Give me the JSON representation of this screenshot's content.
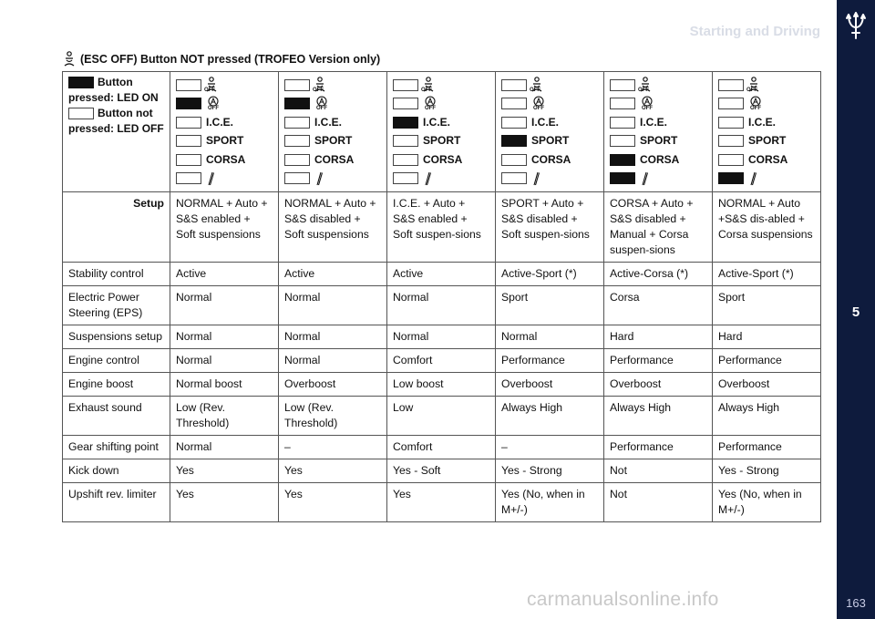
{
  "header": {
    "title": "Starting and Driving"
  },
  "sidebar": {
    "chapter": "5",
    "page": "163",
    "logo": "trident-icon"
  },
  "section": {
    "heading": "(ESC OFF) Button NOT pressed (TROFEO Version only)",
    "icon": "esc-off-icon"
  },
  "legend": {
    "on_label": "Button pressed: LED ON",
    "off_label": "Button not pressed: LED OFF"
  },
  "switch_labels": {
    "esc_off": "OFF",
    "auto_off": "OFF",
    "ice": "I.C.E.",
    "sport": "SPORT",
    "corsa": "CORSA"
  },
  "columns": [
    {
      "on": [
        false,
        true,
        false,
        false,
        false,
        false
      ],
      "setup": "NORMAL + Auto + S&S enabled + Soft suspensions"
    },
    {
      "on": [
        false,
        true,
        false,
        false,
        false,
        false
      ],
      "setup": "NORMAL + Auto + S&S disabled + Soft suspensions"
    },
    {
      "on": [
        false,
        false,
        true,
        false,
        false,
        false
      ],
      "setup": "I.C.E. + Auto + S&S enabled + Soft suspen-sions"
    },
    {
      "on": [
        false,
        false,
        false,
        true,
        false,
        false
      ],
      "setup": "SPORT + Auto + S&S disabled + Soft suspen-sions"
    },
    {
      "on": [
        false,
        false,
        false,
        false,
        true,
        true
      ],
      "setup": "CORSA + Auto + S&S disabled + Manual + Corsa suspen-sions"
    },
    {
      "on": [
        false,
        false,
        false,
        false,
        false,
        true
      ],
      "setup": "NORMAL + Auto +S&S dis-abled + Corsa suspensions"
    }
  ],
  "setup_label": "Setup",
  "rows": [
    {
      "label": "Stability control",
      "values": [
        "Active",
        "Active",
        "Active",
        "Active-Sport (*)",
        "Active-Corsa (*)",
        "Active-Sport (*)"
      ]
    },
    {
      "label": "Electric Power Steering (EPS)",
      "values": [
        "Normal",
        "Normal",
        "Normal",
        "Sport",
        "Corsa",
        "Sport"
      ]
    },
    {
      "label": "Suspensions setup",
      "values": [
        "Normal",
        "Normal",
        "Normal",
        "Normal",
        "Hard",
        "Hard"
      ]
    },
    {
      "label": "Engine control",
      "values": [
        "Normal",
        "Normal",
        "Comfort",
        "Performance",
        "Performance",
        "Performance"
      ]
    },
    {
      "label": "Engine boost",
      "values": [
        "Normal boost",
        "Overboost",
        "Low boost",
        "Overboost",
        "Overboost",
        "Overboost"
      ]
    },
    {
      "label": "Exhaust sound",
      "values": [
        "Low (Rev. Threshold)",
        "Low (Rev. Threshold)",
        "Low",
        "Always High",
        "Always High",
        "Always High"
      ]
    },
    {
      "label": "Gear shifting point",
      "values": [
        "Normal",
        "–",
        "Comfort",
        "–",
        "Performance",
        "Performance"
      ]
    },
    {
      "label": "Kick down",
      "values": [
        "Yes",
        "Yes",
        "Yes - Soft",
        "Yes - Strong",
        "Not",
        "Yes - Strong"
      ]
    },
    {
      "label": "Upshift rev. limiter",
      "values": [
        "Yes",
        "Yes",
        "Yes",
        "Yes (No, when in M+/-)",
        "Not",
        "Yes (No, when in M+/-)"
      ]
    }
  ],
  "watermark": "carmanualsonline.info"
}
